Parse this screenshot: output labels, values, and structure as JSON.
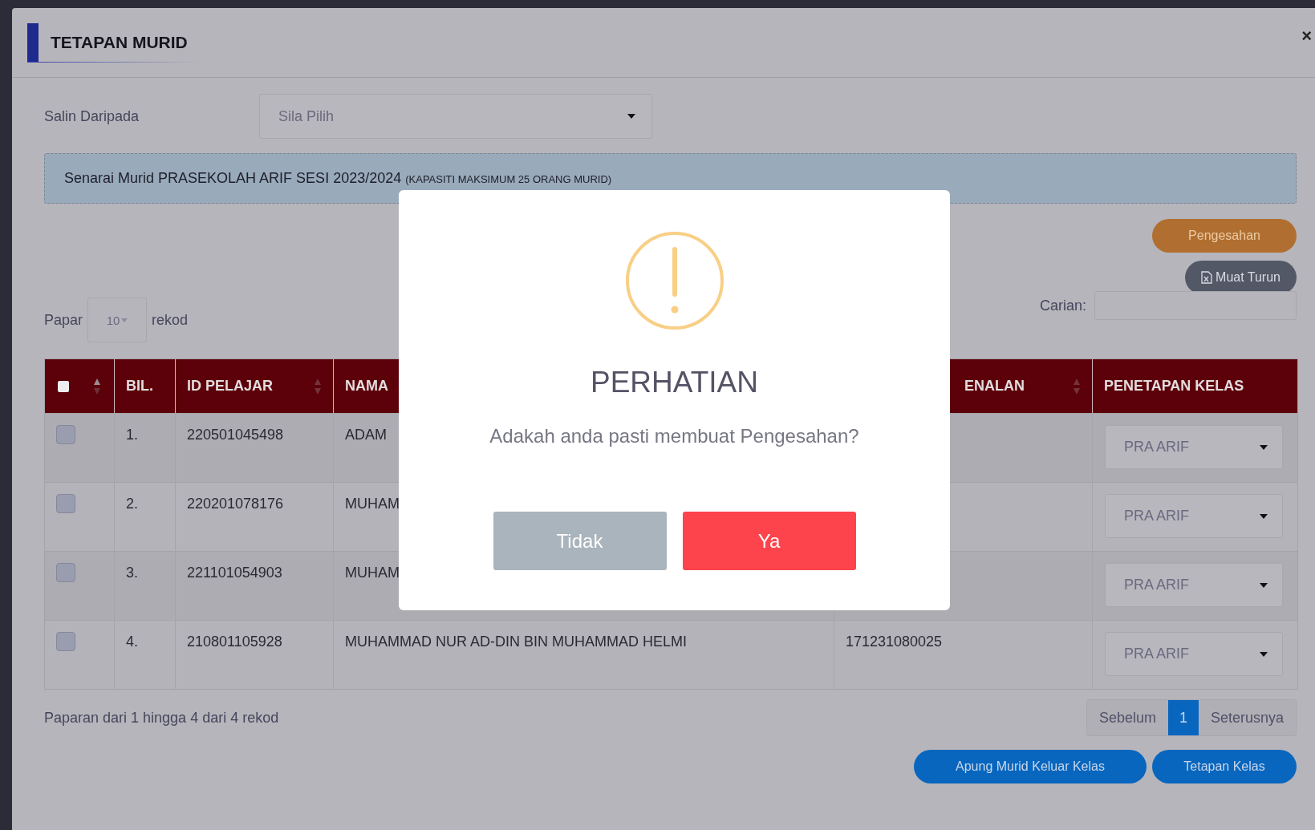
{
  "modal": {
    "title": "TETAPAN MURID",
    "close": "×"
  },
  "copy_from": {
    "label": "Salin Daripada",
    "placeholder": "Sila Pilih"
  },
  "banner": {
    "text": "Senarai Murid PRASEKOLAH ARIF SESI 2023/2024",
    "note": "(KAPASITI MAKSIMUM 25 ORANG MURID)"
  },
  "actions": [
    {
      "label": "Pengesahan",
      "kind": "confirm"
    },
    {
      "label": "Muat Turun",
      "kind": "download"
    }
  ],
  "length": {
    "before": "Papar",
    "value": "10",
    "after": "rekod"
  },
  "search": {
    "label": "Carian:"
  },
  "table": {
    "select_all": {
      "checked": false
    },
    "columns": [
      {
        "label": "BIL.",
        "sortable": false,
        "kind": "num"
      },
      {
        "label": "ID PELAJAR",
        "sortable": true,
        "kind": "id"
      },
      {
        "label": "NAMA",
        "sortable": false,
        "kind": "name"
      },
      {
        "label": "ENALAN",
        "sortable": true,
        "kind": "ic"
      },
      {
        "label": "PENETAPAN KELAS",
        "sortable": false,
        "kind": "class"
      }
    ],
    "rows": [
      {
        "checked": false,
        "no": "1.",
        "id": "220501045498",
        "name": "ADAM",
        "ic": "",
        "kelas": "PRA ARIF"
      },
      {
        "checked": false,
        "no": "2.",
        "id": "220201078176",
        "name": "MUHAM",
        "ic": "",
        "kelas": "PRA ARIF"
      },
      {
        "checked": false,
        "no": "3.",
        "id": "221101054903",
        "name": "MUHAM",
        "ic": "",
        "kelas": "PRA ARIF"
      },
      {
        "checked": false,
        "no": "4.",
        "id": "210801105928",
        "name": "MUHAMMAD NUR AD-DIN BIN MUHAMMAD HELMI",
        "ic": "171231080025",
        "kelas": "PRA ARIF"
      }
    ]
  },
  "info": "Paparan dari 1 hingga 4 dari 4 rekod",
  "pagination": [
    {
      "label": "Sebelum",
      "selected": false
    },
    {
      "label": "1",
      "selected": true
    },
    {
      "label": "Seterusnya",
      "selected": false
    }
  ],
  "footer_buttons": [
    "Apung Murid Keluar Kelas",
    "Tetapan Kelas"
  ],
  "dialog": {
    "title": "PERHATIAN",
    "message": "Adakah anda pasti membuat Pengesahan?",
    "buttons": [
      {
        "label": "Tidak",
        "kind": "cancel"
      },
      {
        "label": "Ya",
        "kind": "confirm"
      }
    ]
  }
}
